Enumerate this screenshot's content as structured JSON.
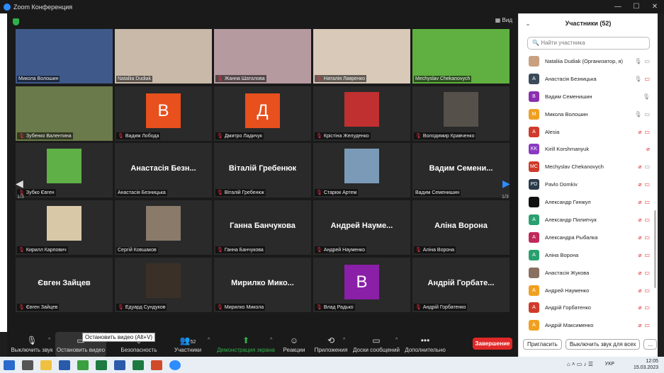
{
  "window": {
    "title": "Zoom Конференция",
    "view_label": "Вид"
  },
  "grid": {
    "page_left": "1/3",
    "page_right": "1/3",
    "tiles": [
      {
        "name": "Микола Волошин",
        "kind": "photo",
        "color": "#3f5a8a",
        "muted": false
      },
      {
        "name": "Nataliia Dudiak",
        "kind": "photo",
        "color": "#c9b9a8",
        "muted": false
      },
      {
        "name": "Жанна Шаталова",
        "kind": "photo",
        "color": "#b59aa0",
        "muted": true
      },
      {
        "name": "Наталія Лавренко",
        "kind": "photo",
        "color": "#d9c9b8",
        "muted": true
      },
      {
        "name": "Mechyslav Chekanovych",
        "kind": "photo",
        "color": "#5fb040",
        "muted": false
      },
      {
        "name": "Зубенко Валентина",
        "kind": "photo",
        "color": "#6a7a4a",
        "muted": true
      },
      {
        "name": "Вадим Лобода",
        "kind": "letter",
        "letter": "В",
        "color": "#e8501e",
        "muted": true
      },
      {
        "name": "Дмитро Ладичук",
        "kind": "letter",
        "letter": "Д",
        "color": "#e8501e",
        "muted": true
      },
      {
        "name": "Крістіна Желуденко",
        "kind": "thumb",
        "color": "#c03030",
        "muted": true
      },
      {
        "name": "Володимир Кравченко",
        "kind": "thumb",
        "color": "#55504a",
        "muted": true
      },
      {
        "name": "Зубко Євген",
        "kind": "thumb",
        "color": "#60b048",
        "muted": true
      },
      {
        "name": "Анастасія Безницька",
        "kind": "text",
        "big": "Анастасія Безн...",
        "muted": false
      },
      {
        "name": "Віталій Гребенюк",
        "kind": "text",
        "big": "Віталій Гребенюк",
        "muted": true
      },
      {
        "name": "Старюк Артем",
        "kind": "thumb",
        "color": "#7a9ab8",
        "muted": true
      },
      {
        "name": "Вадим Семенишин",
        "kind": "text",
        "big": "Вадим Семени...",
        "muted": false
      },
      {
        "name": "Кирилл Карпович",
        "kind": "thumb",
        "color": "#d8c8a8",
        "muted": true
      },
      {
        "name": "Сергій Ковшаков",
        "kind": "thumb",
        "color": "#8a7a6a",
        "muted": false
      },
      {
        "name": "Ганна Банчукова",
        "kind": "text",
        "big": "Ганна Банчукова",
        "muted": true
      },
      {
        "name": "Андрей Науменко",
        "kind": "text",
        "big": "Андрей Науме...",
        "muted": true
      },
      {
        "name": "Аліна Ворона",
        "kind": "text",
        "big": "Аліна Ворона",
        "muted": true
      },
      {
        "name": "Євген Зайцев",
        "kind": "text",
        "big": "Євген Зайцев",
        "muted": true
      },
      {
        "name": "Едуард Сундуков",
        "kind": "thumb",
        "color": "#3a3028",
        "muted": true
      },
      {
        "name": "Мирилко Микола",
        "kind": "text",
        "big": "Мирилко Мико...",
        "muted": true
      },
      {
        "name": "Влад Радько",
        "kind": "letter",
        "letter": "В",
        "color": "#8a1fa8",
        "muted": true
      },
      {
        "name": "Андрій Горбатенко",
        "kind": "text",
        "big": "Андрій Горбате...",
        "muted": true
      }
    ]
  },
  "toolbar": {
    "mute": "Выключить звук",
    "stop_video": "Остановить видео",
    "security": "Безопасность",
    "participants": "Участники",
    "participants_count": "52",
    "share": "Демонстрация экрана",
    "reactions": "Реакции",
    "apps": "Приложения",
    "whiteboard": "Доски сообщений",
    "more": "Дополнительно",
    "end": "Завершение",
    "tooltip": "Остановить видео (Alt+V)"
  },
  "panel": {
    "title": "Участники (52)",
    "search_placeholder": "Найти участника",
    "invite": "Пригласить",
    "mute_all": "Выключить звук для всех",
    "more": "...",
    "participants": [
      {
        "initials": "",
        "name": "Nataliia Dudiak (Организатор, я)",
        "color": "#c9a080",
        "mic": "on",
        "cam": "on"
      },
      {
        "initials": "А",
        "name": "Анастасія Безницька",
        "color": "#3a4a5a",
        "mic": "on",
        "cam": "off"
      },
      {
        "initials": "В",
        "name": "Вадим Семенишин",
        "color": "#8a2fb0",
        "mic": "on",
        "cam": ""
      },
      {
        "initials": "М",
        "name": "Микола Волошин",
        "color": "#f0a020",
        "mic": "on",
        "cam": "on"
      },
      {
        "initials": "А",
        "name": "Alesia",
        "color": "#d03a2a",
        "mic": "off",
        "cam": "off"
      },
      {
        "initials": "KK",
        "name": "Kirill Korshmanyuk",
        "color": "#8a3ac0",
        "mic": "off",
        "cam": ""
      },
      {
        "initials": "MC",
        "name": "Mechyslav Chekanovych",
        "color": "#d03a2a",
        "mic": "off",
        "cam": "on"
      },
      {
        "initials": "PD",
        "name": "Pavlo Domkiv",
        "color": "#2a3a4a",
        "mic": "off",
        "cam": "off"
      },
      {
        "initials": "",
        "name": "Александр Гинжул",
        "color": "#111111",
        "mic": "off",
        "cam": "off"
      },
      {
        "initials": "А",
        "name": "Александр Пилипчук",
        "color": "#2aa070",
        "mic": "off",
        "cam": "off"
      },
      {
        "initials": "А",
        "name": "Александра Рыбалка",
        "color": "#c02a5a",
        "mic": "off",
        "cam": "off"
      },
      {
        "initials": "А",
        "name": "Аліна Ворона",
        "color": "#2aa070",
        "mic": "off",
        "cam": "off"
      },
      {
        "initials": "",
        "name": "Анастасія Жукова",
        "color": "#8a7060",
        "mic": "off",
        "cam": "off"
      },
      {
        "initials": "А",
        "name": "Андрей Науменко",
        "color": "#f0a020",
        "mic": "off",
        "cam": "off"
      },
      {
        "initials": "А",
        "name": "Андрій Горбатенко",
        "color": "#d03a2a",
        "mic": "off",
        "cam": "off"
      },
      {
        "initials": "А",
        "name": "Андрій Максименко",
        "color": "#f0a020",
        "mic": "off",
        "cam": "off"
      }
    ]
  },
  "taskbar": {
    "time": "12:05",
    "date": "15.03.2023",
    "lang": "УКР"
  }
}
